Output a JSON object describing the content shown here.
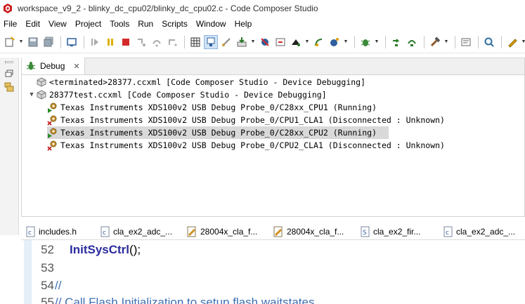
{
  "window": {
    "title": "workspace_v9_2 - blinky_dc_cpu02/blinky_dc_cpu02.c - Code Composer Studio"
  },
  "menu": [
    "File",
    "Edit",
    "View",
    "Project",
    "Tools",
    "Run",
    "Scripts",
    "Window",
    "Help"
  ],
  "debug_view": {
    "tab_label": "Debug",
    "tab_close": "✕",
    "items": [
      {
        "text": "<terminated>28377.ccxml [Code Composer Studio - Device Debugging]",
        "state": "terminated"
      },
      {
        "text": "28377test.ccxml [Code Composer Studio - Device Debugging]",
        "state": "session"
      },
      {
        "text": "Texas Instruments XDS100v2 USB Debug Probe_0/C28xx_CPU1 (Running)",
        "state": "running"
      },
      {
        "text": "Texas Instruments XDS100v2 USB Debug Probe_0/CPU1_CLA1 (Disconnected : Unknown)",
        "state": "disconnected"
      },
      {
        "text": "Texas Instruments XDS100v2 USB Debug Probe_0/C28xx_CPU2 (Running)",
        "state": "running",
        "selected": true
      },
      {
        "text": "Texas Instruments XDS100v2 USB Debug Probe_0/CPU2_CLA1 (Disconnected : Unknown)",
        "state": "disconnected"
      }
    ]
  },
  "editor_tabs": [
    {
      "label": "includes.h",
      "icon": "c-header-file-icon"
    },
    {
      "label": "cla_ex2_adc_...",
      "icon": "c-file-icon"
    },
    {
      "label": "28004x_cla_f...",
      "icon": "linker-cmd-file-icon"
    },
    {
      "label": "28004x_cla_f...",
      "icon": "linker-cmd-file-icon"
    },
    {
      "label": "cla_ex2_fir...",
      "icon": "asm-file-icon"
    },
    {
      "label": "cla_ex2_adc_...",
      "icon": "c-file-icon"
    }
  ],
  "code": {
    "lines": [
      {
        "num": "52",
        "func": "InitSysCtrl",
        "rest": "();"
      },
      {
        "num": "53",
        "text": ""
      },
      {
        "num": "54",
        "comment": "//"
      },
      {
        "num": "55",
        "comment": "// Call Flash Initialization to setup flash waitstates"
      }
    ]
  },
  "colors": {
    "selection": "#d9d9d9",
    "keyword": "#2a2a9f",
    "comment": "#3f6fb1",
    "gutter_strip": "#e4eff7"
  }
}
